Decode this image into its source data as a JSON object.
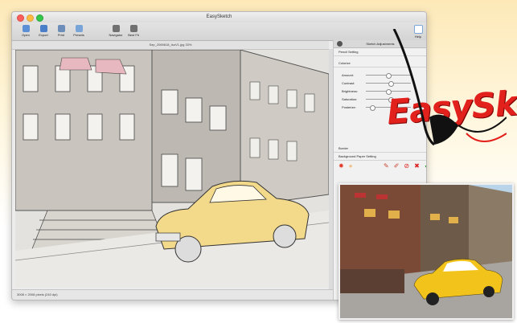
{
  "window": {
    "title": "EasySketch"
  },
  "toolbar": {
    "open": "Open",
    "export": "Export",
    "print": "Print",
    "presets": "Presets",
    "navigator": "Navigator",
    "best_fit": "Best Fit",
    "help": "Help"
  },
  "document": {
    "title": "Sep_2069818_IsoV1.jpg 33%",
    "status": "3008 × 2008 pixels (240 dpi)"
  },
  "panel": {
    "header": "Sketch Adjustments",
    "pencil_setting": "Pencil Setting",
    "colorize": "Colorize",
    "sliders": [
      {
        "label": "Amount:",
        "value": 0.5
      },
      {
        "label": "Contrast:",
        "value": 0.55
      },
      {
        "label": "Brightness:",
        "value": 0.5
      },
      {
        "label": "Saturation:",
        "value": 0.55
      },
      {
        "label": "Posterize:",
        "value": 0.15
      }
    ],
    "border": "Border",
    "background_paper_setting": "Background Paper Setting"
  },
  "logo": {
    "text": "EasySketch"
  },
  "colors": {
    "accent_red": "#e2201c",
    "sky": "#b9d3e8"
  }
}
